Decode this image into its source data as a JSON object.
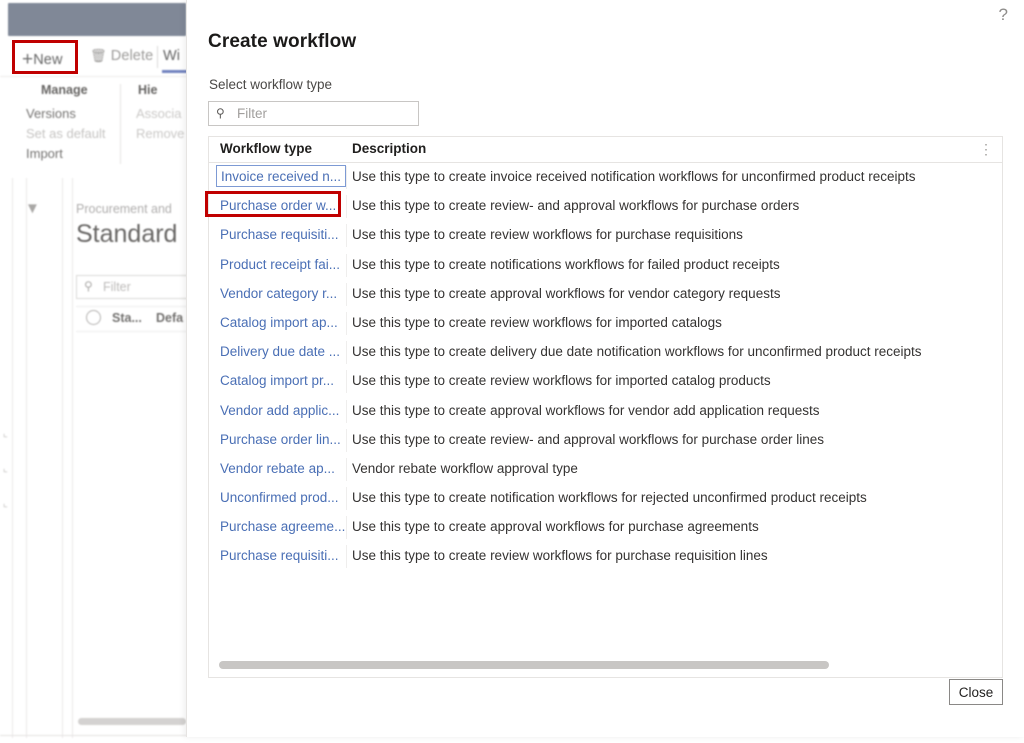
{
  "background_app": {
    "command_bar": {
      "new_label": "New",
      "new_icon": "plus-icon",
      "delete_label": "Delete",
      "delete_icon": "trash-icon",
      "workflow_tab_label": "Wi"
    },
    "ribbon": {
      "groups": [
        {
          "title": "Manage",
          "links": [
            "Versions",
            "Set as default",
            "Import"
          ]
        },
        {
          "title": "Hie",
          "links": [
            "Associa",
            "Remove"
          ]
        }
      ],
      "manage_title": "Manage",
      "hierarchy_title": "Hie",
      "versions": "Versions",
      "set_as_default": "Set as default",
      "import": "Import",
      "associate": "Associa",
      "remove": "Remove"
    },
    "content": {
      "breadcrumb": "Procurement and",
      "page_title": "Standard",
      "filter_placeholder": "Filter",
      "column_status": "Sta...",
      "column_default": "Defa"
    }
  },
  "dialog": {
    "help_icon": "help-question-icon",
    "title": "Create workflow",
    "select_label": "Select workflow type",
    "filter_placeholder": "Filter",
    "filter_value": "",
    "close_label": "Close",
    "grid": {
      "columns": [
        "Workflow type",
        "Description"
      ],
      "overflow_icon": "vertical-ellipsis-icon",
      "selected_row_index": 0,
      "highlighted_row_index": 1,
      "rows": [
        {
          "type": "Invoice received n...",
          "description": "Use this type to create invoice received notification workflows for unconfirmed product receipts"
        },
        {
          "type": "Purchase order w...",
          "description": "Use this type to create review- and approval workflows for purchase orders"
        },
        {
          "type": "Purchase requisiti...",
          "description": "Use this type to create review workflows for purchase requisitions"
        },
        {
          "type": "Product receipt fai...",
          "description": "Use this type to create notifications workflows for failed product receipts"
        },
        {
          "type": "Vendor category r...",
          "description": "Use this type to create approval workflows for vendor category requests"
        },
        {
          "type": "Catalog import ap...",
          "description": "Use this type to create review workflows for imported catalogs"
        },
        {
          "type": "Delivery due date ...",
          "description": "Use this type to create delivery due date notification workflows for unconfirmed product receipts"
        },
        {
          "type": "Catalog import pr...",
          "description": "Use this type to create review workflows for imported catalog products"
        },
        {
          "type": "Vendor add applic...",
          "description": "Use this type to create approval workflows for vendor add application requests"
        },
        {
          "type": "Purchase order lin...",
          "description": "Use this type to create review- and approval workflows for purchase order lines"
        },
        {
          "type": "Vendor rebate ap...",
          "description": "Vendor rebate workflow approval type"
        },
        {
          "type": "Unconfirmed prod...",
          "description": "Use this type to create notification workflows for rejected unconfirmed product receipts"
        },
        {
          "type": "Purchase agreeme...",
          "description": "Use this type to create approval workflows for purchase agreements"
        },
        {
          "type": "Purchase requisiti...",
          "description": "Use this type to create review workflows for purchase requisition lines"
        }
      ]
    }
  },
  "annotations": {
    "accent_color": "#c00000",
    "boxes": [
      "new-button",
      "purchase-order-workflow-row"
    ]
  },
  "colors": {
    "link": "#4a6fb5",
    "topbar": "#6a7486",
    "annotation": "#c00000",
    "tab_underline": "#5b6fb5"
  }
}
